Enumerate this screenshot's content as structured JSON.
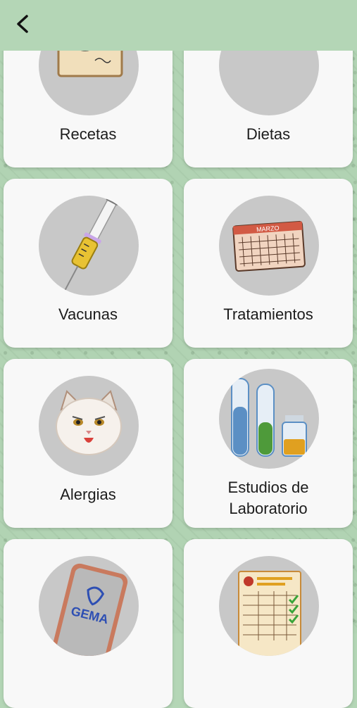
{
  "header": {
    "back_icon": "chevron-left-icon"
  },
  "cards": [
    {
      "label": "Recetas",
      "icon": "prescription-icon"
    },
    {
      "label": "Dietas",
      "icon": "pet-food-bowl-icon"
    },
    {
      "label": "Vacunas",
      "icon": "syringe-icon"
    },
    {
      "label": "Tratamientos",
      "icon": "calendar-icon",
      "icon_text": "MARZO"
    },
    {
      "label": "Alergias",
      "icon": "cat-icon"
    },
    {
      "label_line1": "Estudios de",
      "label_line2": "Laboratorio",
      "icon": "test-tubes-icon"
    },
    {
      "icon": "phone-icon",
      "icon_text": "GEMA"
    },
    {
      "icon": "checklist-icon"
    }
  ],
  "colors": {
    "header": "#b4d6b6",
    "card": "#f8f8f8",
    "icon_circle": "#c8c8c8"
  }
}
